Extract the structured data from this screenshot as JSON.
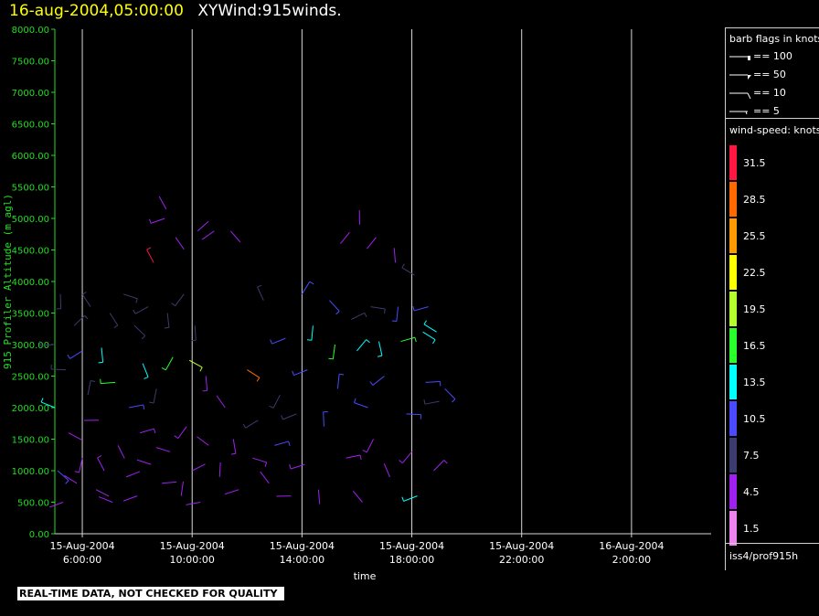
{
  "header": {
    "date": "16-aug-2004,05:00:00",
    "title": "XYWind:915winds."
  },
  "legend": {
    "flags_title": "barb flags in knots",
    "flags": [
      {
        "label": "== 100",
        "knots": 100
      },
      {
        "label": "== 50",
        "knots": 50
      },
      {
        "label": "== 10",
        "knots": 10
      },
      {
        "label": "== 5",
        "knots": 5
      }
    ],
    "speed_title": "wind-speed: knots",
    "speed_levels": [
      {
        "label": "31.5",
        "color": "#ff1744"
      },
      {
        "label": "28.5",
        "color": "#ff6a00"
      },
      {
        "label": "25.5",
        "color": "#ff9b00"
      },
      {
        "label": "22.5",
        "color": "#ffff00"
      },
      {
        "label": "19.5",
        "color": "#b5ff2a"
      },
      {
        "label": "16.5",
        "color": "#2bff2b"
      },
      {
        "label": "13.5",
        "color": "#00ffff"
      },
      {
        "label": "10.5",
        "color": "#4a4aff"
      },
      {
        "label": "7.5",
        "color": "#3c3c6e"
      },
      {
        "label": "4.5",
        "color": "#a020f0"
      },
      {
        "label": "1.5",
        "color": "#ee82ee"
      }
    ],
    "station": "iss4/prof915h"
  },
  "notice": "REAL-TIME DATA, NOT CHECKED FOR QUALITY",
  "chart_data": {
    "type": "scatter",
    "title": "XYWind:915winds.",
    "xlabel": "time",
    "ylabel": "915 Profiler Altitude (m agl)",
    "ylim": [
      0,
      8000
    ],
    "yticks": [
      "0.00",
      "500.00",
      "1000.00",
      "1500.00",
      "2000.00",
      "2500.00",
      "3000.00",
      "3500.00",
      "4000.00",
      "4500.00",
      "5000.00",
      "5500.00",
      "6000.00",
      "6500.00",
      "7000.00",
      "7500.00",
      "8000.00"
    ],
    "xticks": [
      {
        "date": "15-Aug-2004",
        "time": "6:00:00",
        "hours": 6
      },
      {
        "date": "15-Aug-2004",
        "time": "10:00:00",
        "hours": 10
      },
      {
        "date": "15-Aug-2004",
        "time": "14:00:00",
        "hours": 14
      },
      {
        "date": "15-Aug-2004",
        "time": "18:00:00",
        "hours": 18
      },
      {
        "date": "15-Aug-2004",
        "time": "22:00:00",
        "hours": 22
      },
      {
        "date": "16-Aug-2004",
        "time": "2:00:00",
        "hours": 26
      }
    ],
    "xlim_hours": [
      5.0,
      28.9
    ],
    "grid": "vertical",
    "axis_color": "#22dd22",
    "series": [
      {
        "name": "wind barbs",
        "points": [
          [
            5.0,
            3000,
            6
          ],
          [
            5.0,
            2000,
            14
          ],
          [
            5.1,
            1000,
            9
          ],
          [
            5.2,
            3800,
            6
          ],
          [
            5.3,
            500,
            4
          ],
          [
            5.4,
            2600,
            8
          ],
          [
            5.5,
            1600,
            3
          ],
          [
            5.7,
            3300,
            7
          ],
          [
            5.8,
            800,
            4
          ],
          [
            6.0,
            2900,
            11
          ],
          [
            6.0,
            1200,
            5
          ],
          [
            6.2,
            2200,
            6
          ],
          [
            6.3,
            3600,
            7
          ],
          [
            6.5,
            700,
            3
          ],
          [
            6.6,
            1800,
            4
          ],
          [
            6.7,
            2950,
            12
          ],
          [
            6.8,
            1000,
            5
          ],
          [
            7.0,
            3500,
            8
          ],
          [
            7.1,
            500,
            3
          ],
          [
            7.2,
            2400,
            15
          ],
          [
            7.3,
            1400,
            4
          ],
          [
            7.5,
            3800,
            7
          ],
          [
            7.6,
            900,
            4
          ],
          [
            7.7,
            2000,
            9
          ],
          [
            7.9,
            3300,
            8
          ],
          [
            8.0,
            600,
            3
          ],
          [
            8.1,
            1600,
            5
          ],
          [
            8.2,
            2700,
            14
          ],
          [
            8.4,
            3600,
            7
          ],
          [
            8.5,
            1100,
            4
          ],
          [
            8.6,
            4300,
            30
          ],
          [
            8.7,
            2300,
            6
          ],
          [
            8.8,
            5350,
            4
          ],
          [
            8.9,
            800,
            3
          ],
          [
            9.0,
            5000,
            5
          ],
          [
            9.1,
            3500,
            7
          ],
          [
            9.2,
            1300,
            4
          ],
          [
            9.3,
            2800,
            17
          ],
          [
            9.4,
            4700,
            4
          ],
          [
            9.6,
            600,
            3
          ],
          [
            9.7,
            3800,
            7
          ],
          [
            9.8,
            1700,
            5
          ],
          [
            9.9,
            2750,
            18
          ],
          [
            10.0,
            1000,
            4
          ],
          [
            10.1,
            3300,
            6
          ],
          [
            10.2,
            4800,
            3
          ],
          [
            10.3,
            500,
            4
          ],
          [
            10.5,
            2500,
            5
          ],
          [
            10.6,
            1400,
            4
          ],
          [
            10.8,
            4800,
            4
          ],
          [
            11.0,
            900,
            3
          ],
          [
            11.2,
            2000,
            4
          ],
          [
            11.4,
            4800,
            3
          ],
          [
            11.5,
            1500,
            5
          ],
          [
            11.7,
            700,
            4
          ],
          [
            12.0,
            2600,
            27
          ],
          [
            12.2,
            1200,
            5
          ],
          [
            12.4,
            1800,
            6
          ],
          [
            12.6,
            3700,
            7
          ],
          [
            12.8,
            800,
            4
          ],
          [
            13.0,
            1400,
            10
          ],
          [
            13.2,
            2200,
            8
          ],
          [
            13.4,
            3100,
            9
          ],
          [
            13.6,
            600,
            4
          ],
          [
            13.8,
            1900,
            8
          ],
          [
            14.0,
            3800,
            10
          ],
          [
            14.1,
            1100,
            5
          ],
          [
            14.2,
            2600,
            11
          ],
          [
            14.4,
            3300,
            12
          ],
          [
            14.6,
            700,
            4
          ],
          [
            14.8,
            1700,
            9
          ],
          [
            15.0,
            3700,
            11
          ],
          [
            15.2,
            3000,
            16
          ],
          [
            15.3,
            2300,
            10
          ],
          [
            15.4,
            4600,
            4
          ],
          [
            15.6,
            1200,
            5
          ],
          [
            15.8,
            3400,
            8
          ],
          [
            16.0,
            2900,
            12
          ],
          [
            16.1,
            4900,
            4
          ],
          [
            16.2,
            500,
            4
          ],
          [
            16.4,
            2000,
            10
          ],
          [
            16.5,
            3600,
            8
          ],
          [
            16.6,
            1500,
            5
          ],
          [
            16.7,
            4700,
            4
          ],
          [
            16.8,
            3050,
            14
          ],
          [
            17.0,
            2500,
            10
          ],
          [
            17.2,
            900,
            4
          ],
          [
            17.4,
            4300,
            4
          ],
          [
            17.5,
            3600,
            9
          ],
          [
            17.6,
            3050,
            15
          ],
          [
            17.8,
            1900,
            9
          ],
          [
            18.0,
            1300,
            5
          ],
          [
            18.1,
            4100,
            6
          ],
          [
            18.2,
            600,
            13
          ],
          [
            18.4,
            3200,
            14
          ],
          [
            18.5,
            2400,
            9
          ],
          [
            18.6,
            3600,
            10
          ],
          [
            18.8,
            1000,
            5
          ],
          [
            18.9,
            3200,
            12
          ],
          [
            19.0,
            2100,
            7
          ],
          [
            19.2,
            2300,
            9
          ]
        ]
      }
    ]
  }
}
